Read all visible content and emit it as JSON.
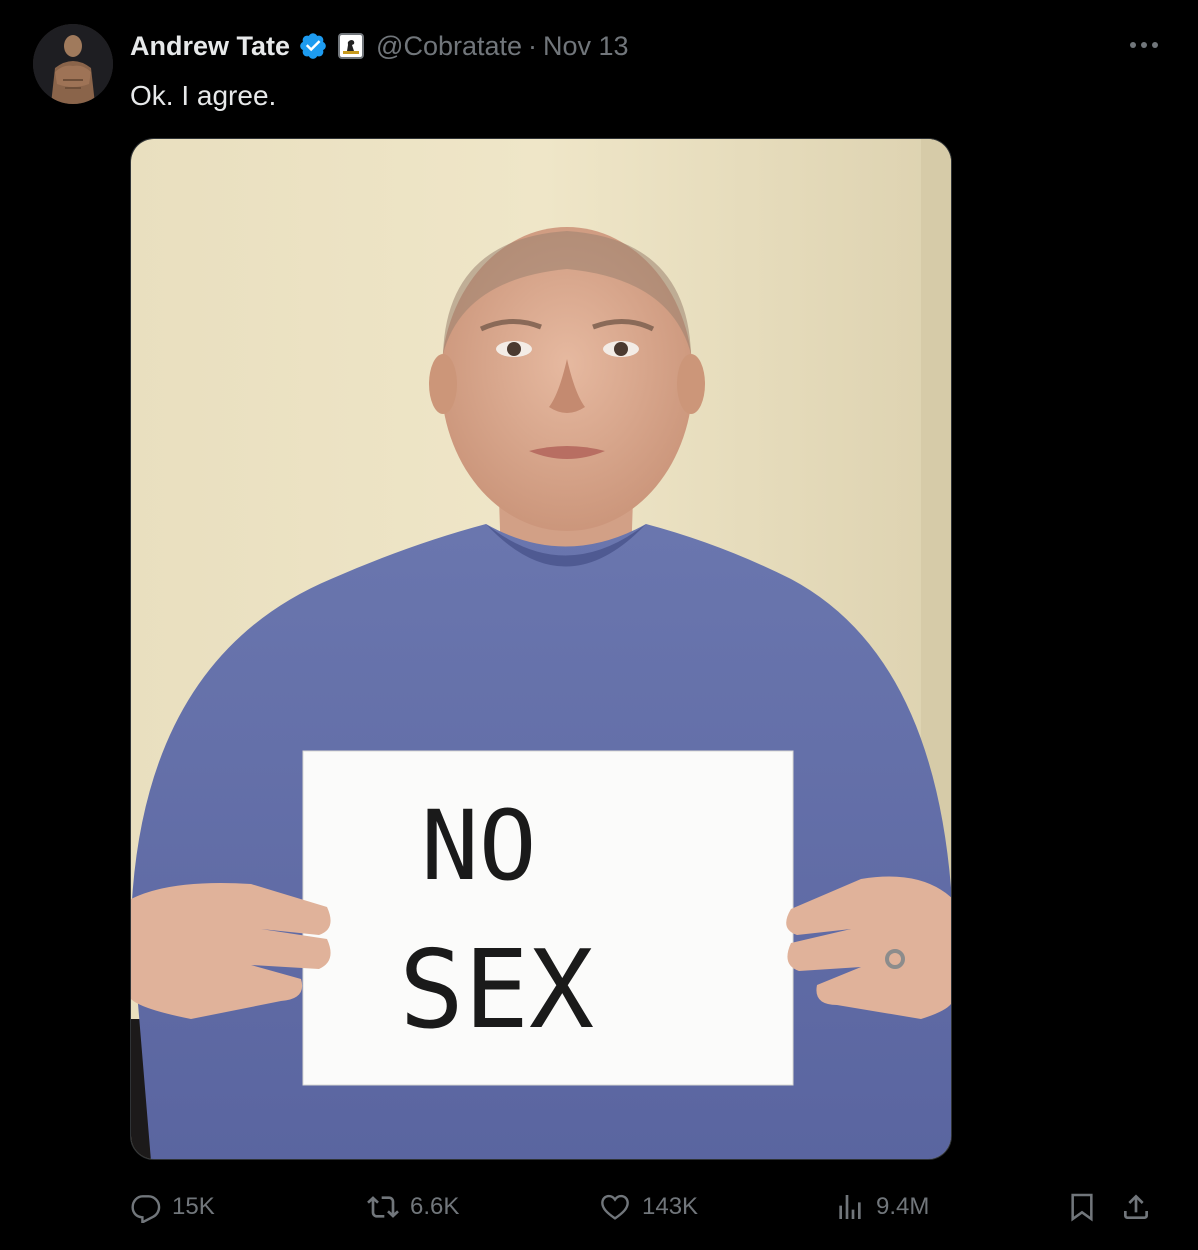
{
  "post": {
    "author": {
      "display_name": "Andrew Tate",
      "handle": "@Cobratate",
      "verified": true
    },
    "separator": "·",
    "date": "Nov 13",
    "text": "Ok. I agree.",
    "media": {
      "sign_lines": [
        "NO",
        "SEX"
      ]
    },
    "metrics": {
      "replies": "15K",
      "reposts": "6.6K",
      "likes": "143K",
      "views": "9.4M"
    }
  },
  "colors": {
    "background": "#000000",
    "primary_text": "#e7e9ea",
    "secondary_text": "#71767b",
    "verified_blue": "#1d9bf0"
  },
  "icons": {
    "more": "more-horizontal-icon",
    "reply": "reply-icon",
    "repost": "repost-icon",
    "like": "heart-icon",
    "views": "views-icon",
    "bookmark": "bookmark-icon",
    "share": "share-icon"
  }
}
